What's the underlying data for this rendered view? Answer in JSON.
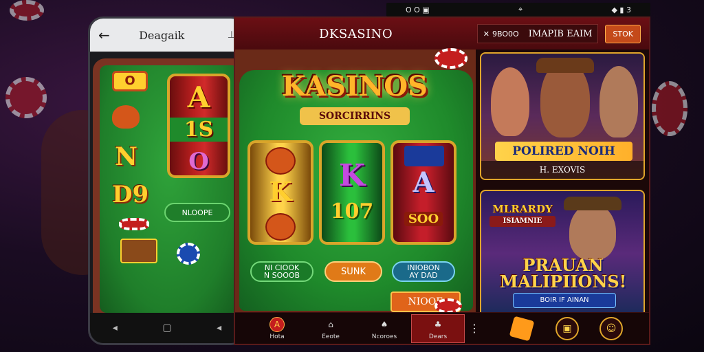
{
  "statusbar": {
    "left_icons": "O  O  ▣",
    "mid": "⌖",
    "right": "◆  ▮ 3"
  },
  "left_phone": {
    "title": "Deagaik",
    "symbols": [
      "O",
      "N",
      "D9"
    ],
    "reel_symbols": [
      "A",
      "1S",
      "O"
    ],
    "pill_label": "NLOOPE",
    "badge": "O"
  },
  "app": {
    "title": "DKSASINO",
    "header_code": "9BO0O",
    "header_name": "IMAPIB EAIM",
    "header_button": "STOK"
  },
  "game": {
    "logo": "KASINOS",
    "sub": "SORCIRRINS",
    "reel1": [
      "K"
    ],
    "reel2": [
      "K",
      "107"
    ],
    "reel3": [
      "A",
      "SOO"
    ],
    "btn1_line1": "NI CIOOK",
    "btn1_line2": "N SOOOB",
    "btn2": "SUNK",
    "btn3_line1": "INIOBON",
    "btn3_line2": "AY DAD",
    "more_button": "NIOOE"
  },
  "promo1": {
    "title": "POLIRED NOIH",
    "subtitle": "H. EXOVIS"
  },
  "promo2": {
    "top1": "MLRARDY",
    "top2": "ISIAMNIE",
    "title": "PRAUAN MALIPIIONS!",
    "subtitle": "BOIR IF AINAN"
  },
  "nav": [
    {
      "label": "Hota",
      "icon": "A"
    },
    {
      "label": "Eeote",
      "icon": "⌂"
    },
    {
      "label": "Ncoroes",
      "icon": "♠"
    },
    {
      "label": "Dears",
      "icon": "♣"
    }
  ],
  "colors": {
    "accent": "#c41e1e",
    "gold": "#e0a62a",
    "felt": "#1f8a2b"
  }
}
